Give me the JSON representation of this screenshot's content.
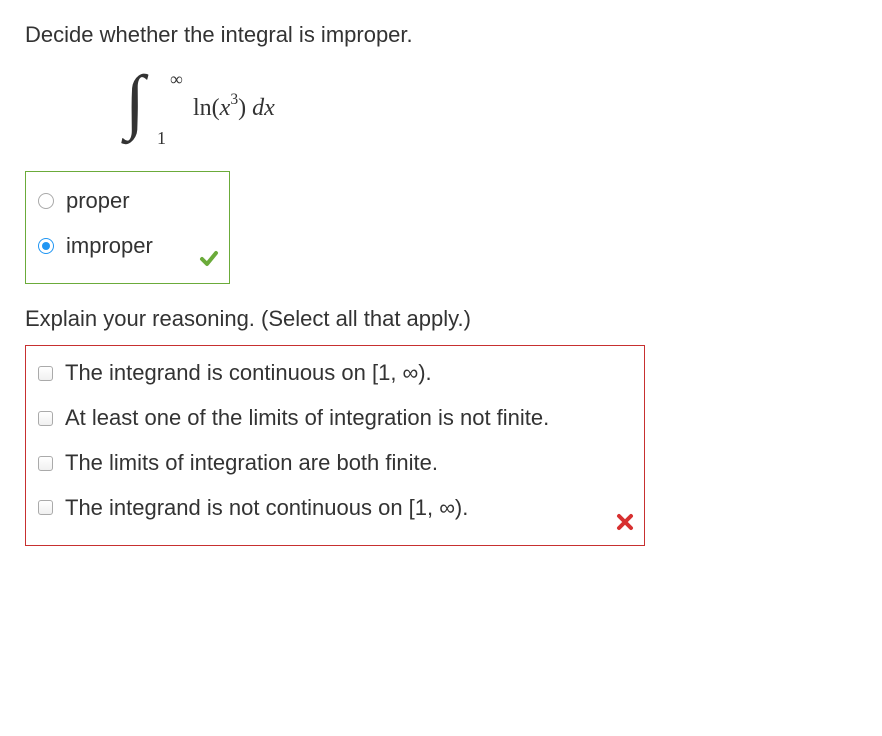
{
  "prompt": "Decide whether the integral is improper.",
  "integral": {
    "upper": "∞",
    "lower": "1",
    "func_prefix": "ln(",
    "var": "x",
    "exp": "3",
    "func_suffix": ") ",
    "dvar": "dx"
  },
  "radios": {
    "proper": "proper",
    "improper": "improper"
  },
  "reasoning_prompt": "Explain your reasoning. (Select all that apply.)",
  "checkboxes": {
    "opt1": "The integrand is continuous on [1, ∞).",
    "opt2": "At least one of the limits of integration is not finite.",
    "opt3": "The limits of integration are both finite.",
    "opt4": "The integrand is not continuous on [1, ∞)."
  }
}
